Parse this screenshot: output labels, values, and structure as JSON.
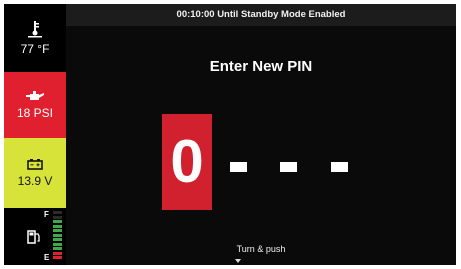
{
  "status_bar": {
    "text": "00:10:00 Until Standby Mode Enabled"
  },
  "sidebar": {
    "temperature": {
      "icon": "coolant-temperature-icon",
      "value": "77 °F"
    },
    "oil_pressure": {
      "icon": "oil-can-icon",
      "value": "18 PSI",
      "color": "#e1202f"
    },
    "battery": {
      "icon": "battery-icon",
      "value": "13.9 V",
      "color": "#d8e33a"
    },
    "fuel": {
      "icon": "fuel-pump-icon",
      "full_label": "F",
      "empty_label": "E",
      "level": 0.85
    }
  },
  "pin_entry": {
    "title": "Enter New PIN",
    "current_digit": "0",
    "remaining_placeholders": 3,
    "hint": "Turn & push",
    "accent": "#d1202e"
  }
}
